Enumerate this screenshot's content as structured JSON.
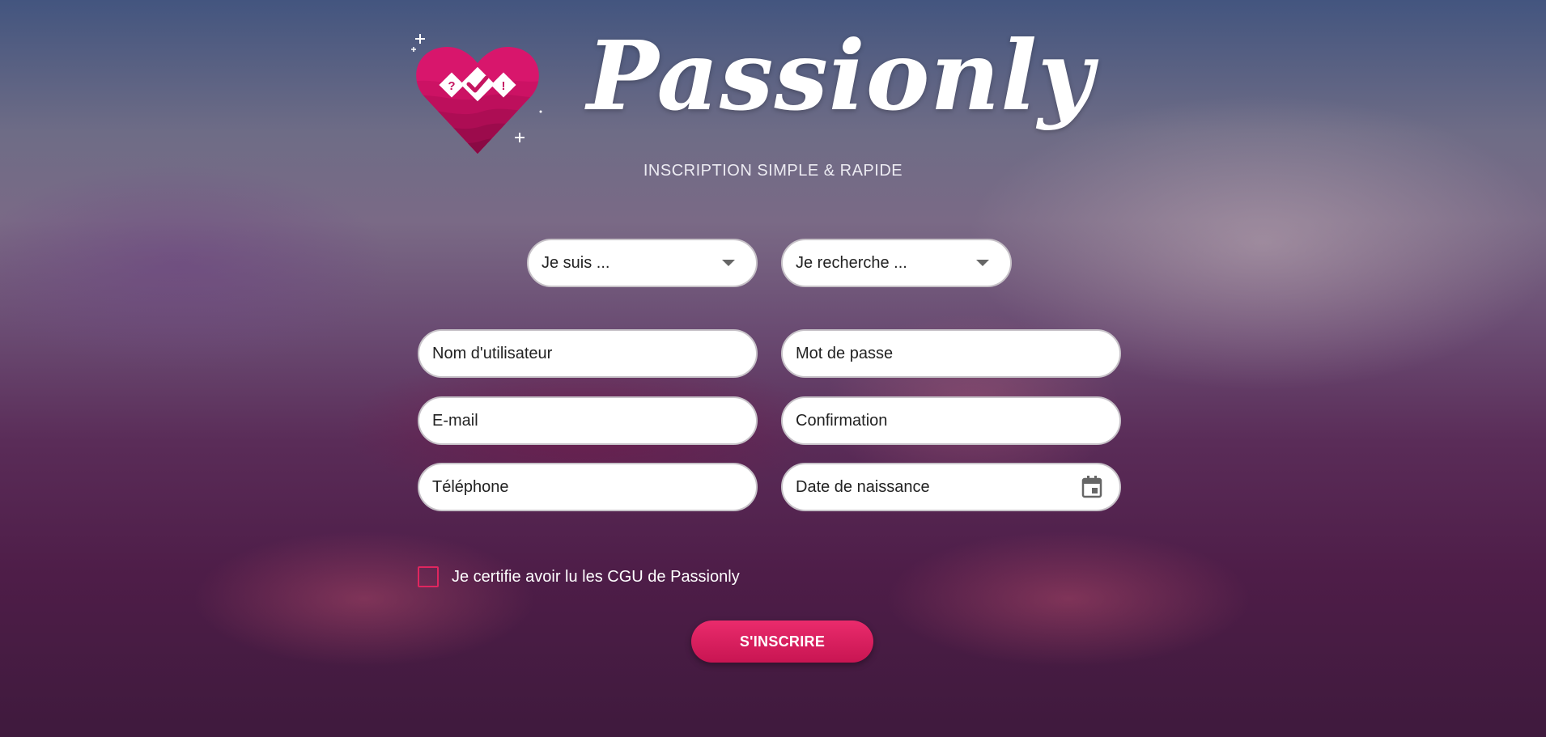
{
  "brand": {
    "name": "Passionly",
    "tagline": "INSCRIPTION SIMPLE & RAPIDE"
  },
  "selects": {
    "gender": "Je suis ...",
    "seeking": "Je recherche ..."
  },
  "fields": {
    "username": "Nom d'utilisateur",
    "password": "Mot de passe",
    "email": "E-mail",
    "confirmation": "Confirmation",
    "phone": "Téléphone",
    "birthdate": "Date de naissance"
  },
  "terms": {
    "label": "Je certifie avoir lu les CGU de Passionly"
  },
  "submit": {
    "label": "S'INSCRIRE"
  },
  "colors": {
    "accent": "#e0265f",
    "heart": "#c51660"
  },
  "icons": {
    "logo": "heart-logo-icon",
    "select_arrow": "chevron-down-icon",
    "calendar": "calendar-icon"
  }
}
